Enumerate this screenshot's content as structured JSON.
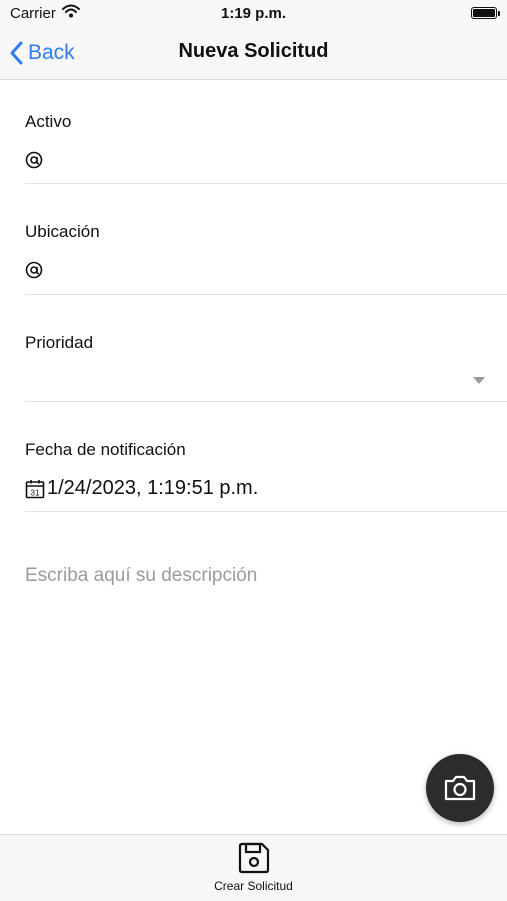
{
  "status_bar": {
    "carrier": "Carrier",
    "time": "1:19 p.m."
  },
  "nav": {
    "back_label": "Back",
    "title": "Nueva Solicitud"
  },
  "form": {
    "activo": {
      "label": "Activo",
      "value": ""
    },
    "ubicacion": {
      "label": "Ubicación",
      "value": ""
    },
    "prioridad": {
      "label": "Prioridad",
      "value": ""
    },
    "fecha": {
      "label": "Fecha de notificación",
      "value": "1/24/2023, 1:19:51 p.m."
    },
    "descripcion": {
      "placeholder": "Escriba aquí su descripción"
    }
  },
  "fab": {
    "icon": "camera-icon"
  },
  "toolbar": {
    "create_label": "Crear Solicitud",
    "icon": "save-icon"
  },
  "colors": {
    "accent": "#2f7cf6",
    "fab_bg": "#2c2c2e",
    "placeholder": "#9b9b9b"
  }
}
